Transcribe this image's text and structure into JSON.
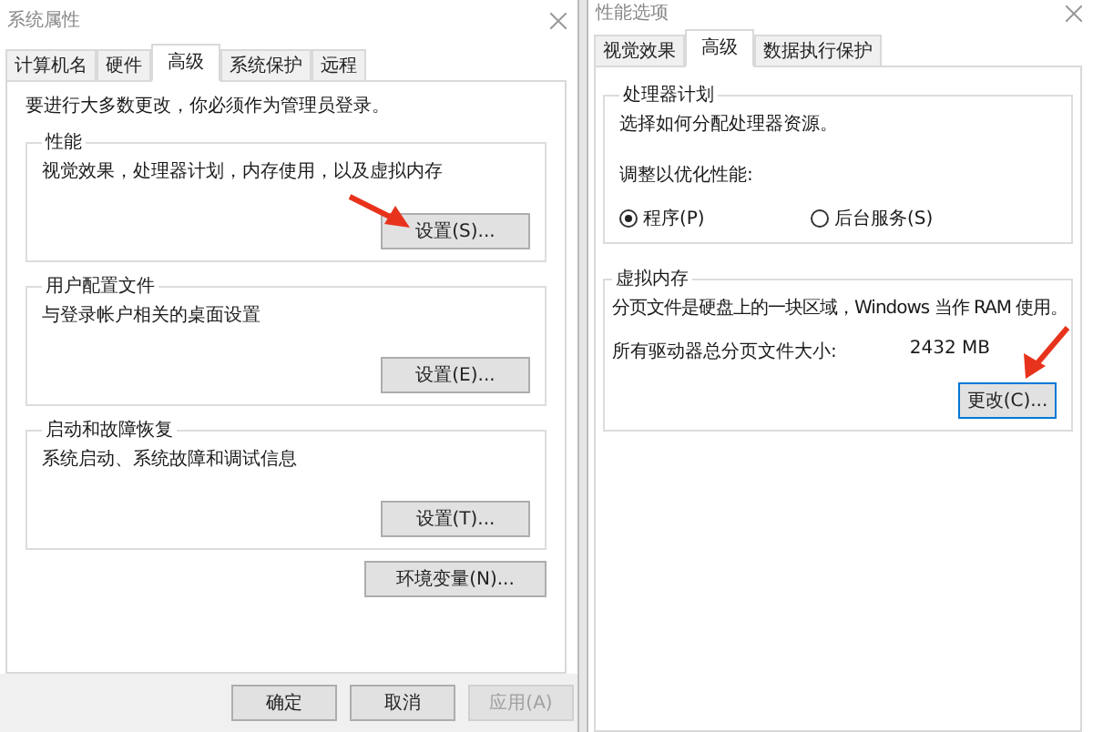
{
  "system_properties": {
    "title": "系统属性",
    "tabs": [
      {
        "label": "计算机名",
        "selected": false
      },
      {
        "label": "硬件",
        "selected": false
      },
      {
        "label": "高级",
        "selected": true
      },
      {
        "label": "系统保护",
        "selected": false
      },
      {
        "label": "远程",
        "selected": false
      }
    ],
    "notice": "要进行大多数更改，你必须作为管理员登录。",
    "groups": [
      {
        "title": "性能",
        "description": "视觉效果，处理器计划，内存使用，以及虚拟内存",
        "button": "设置(S)..."
      },
      {
        "title": "用户配置文件",
        "description": "与登录帐户相关的桌面设置",
        "button": "设置(E)..."
      },
      {
        "title": "启动和故障恢复",
        "description": "系统启动、系统故障和调试信息",
        "button": "设置(T)..."
      }
    ],
    "env_button": "环境变量(N)...",
    "footer_buttons": [
      {
        "label": "确定",
        "disabled": false
      },
      {
        "label": "取消",
        "disabled": false
      },
      {
        "label": "应用(A)",
        "disabled": true
      }
    ]
  },
  "performance_options": {
    "title": "性能选项",
    "tabs": [
      {
        "label": "视觉效果",
        "selected": false
      },
      {
        "label": "高级",
        "selected": true
      },
      {
        "label": "数据执行保护",
        "selected": false
      }
    ],
    "processor_group": {
      "title": "处理器计划",
      "description": "选择如何分配处理器资源。",
      "prompt": "调整以优化性能:",
      "options": [
        {
          "label": "程序(P)",
          "selected": true
        },
        {
          "label": "后台服务(S)",
          "selected": false
        }
      ]
    },
    "virtual_memory": {
      "title": "虚拟内存",
      "description": "分页文件是硬盘上的一块区域，Windows 当作 RAM 使用。",
      "total_label": "所有驱动器总分页文件大小:",
      "total_value": "2432 MB",
      "button": "更改(C)..."
    }
  }
}
